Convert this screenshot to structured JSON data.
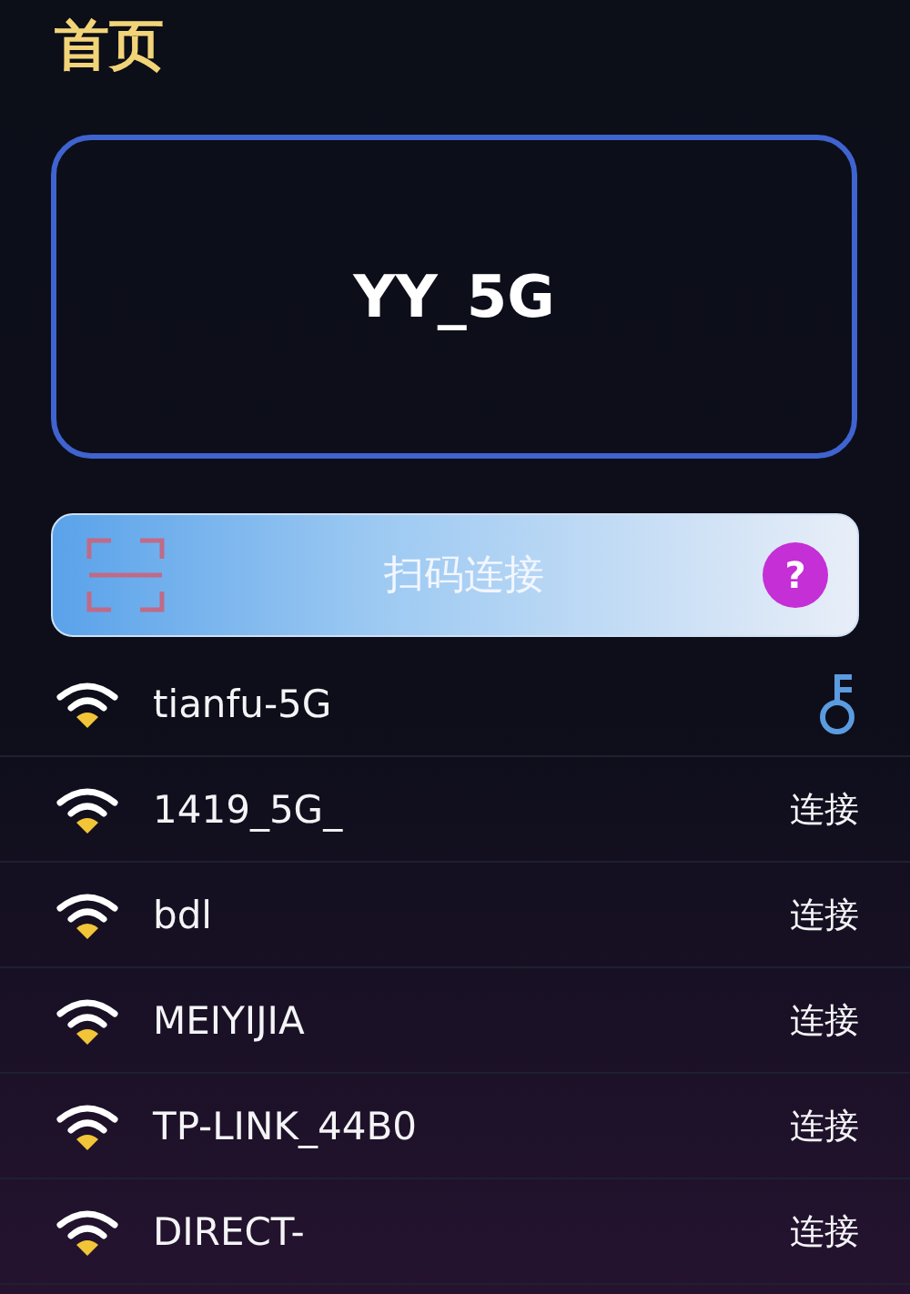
{
  "title": "首页",
  "current_network": {
    "name": "YY_5G"
  },
  "scan_button": {
    "label": "扫码连接",
    "help": "?"
  },
  "networks": [
    {
      "name": "tianfu-5G",
      "kind": "saved"
    },
    {
      "name": "1419_5G_",
      "kind": "connect",
      "action": "连接"
    },
    {
      "name": "bdl",
      "kind": "connect",
      "action": "连接"
    },
    {
      "name": "MEIYIJIA",
      "kind": "connect",
      "action": "连接"
    },
    {
      "name": "TP-LINK_44B0",
      "kind": "connect",
      "action": "连接"
    },
    {
      "name": "DIRECT-",
      "kind": "connect",
      "action": "连接"
    }
  ]
}
